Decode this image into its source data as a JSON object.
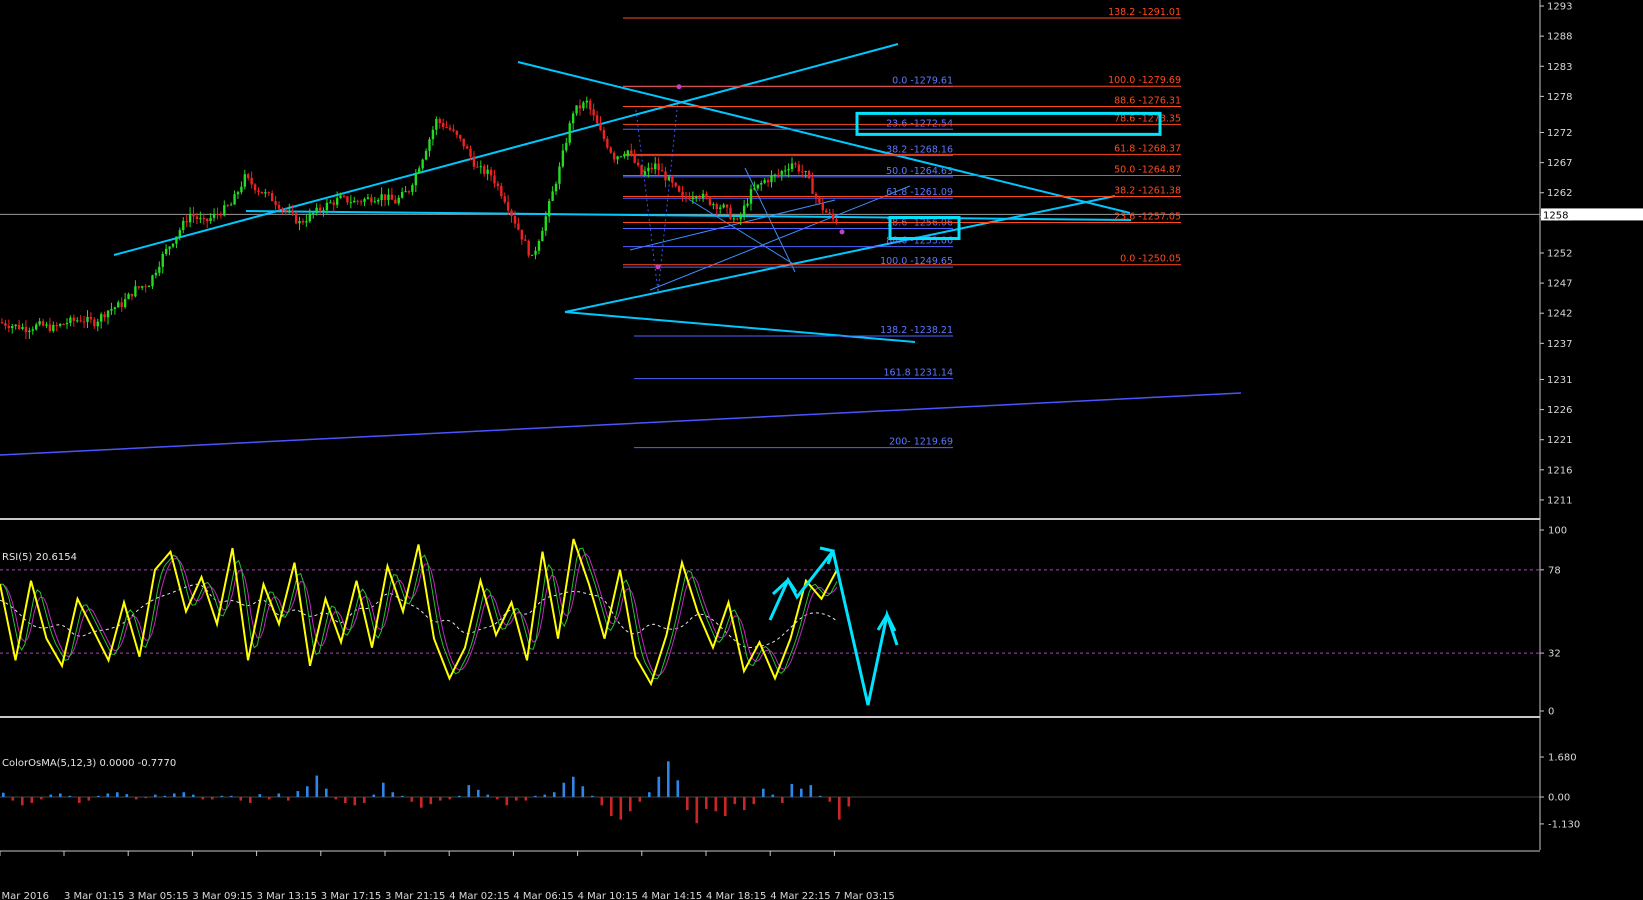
{
  "chart_data": [
    {
      "type": "candlestick",
      "panel": "price",
      "ylim": [
        1208,
        1294
      ],
      "y_ticks": [
        "1293",
        "1288",
        "1283",
        "1278",
        "1272",
        "1267",
        "1262",
        "1258",
        "1252",
        "1247",
        "1242",
        "1237",
        "1231",
        "1226",
        "1221",
        "1216",
        "1211"
      ],
      "x_ticks": [
        "2 Mar 2016",
        "3 Mar 01:15",
        "3 Mar 05:15",
        "3 Mar 09:15",
        "3 Mar 13:15",
        "3 Mar 17:15",
        "3 Mar 21:15",
        "4 Mar 02:15",
        "4 Mar 06:15",
        "4 Mar 10:15",
        "4 Mar 14:15",
        "4 Mar 18:15",
        "4 Mar 22:15",
        "7 Mar 03:15"
      ],
      "current_price_tag": "1258",
      "current_price": 1258.4,
      "close_path": [
        [
          0,
          1240.5
        ],
        [
          4,
          1240
        ],
        [
          8,
          1239.5
        ],
        [
          12,
          1240
        ],
        [
          16,
          1239.5
        ],
        [
          20,
          1240.5
        ],
        [
          24,
          1241
        ],
        [
          28,
          1240.5
        ],
        [
          32,
          1242.5
        ],
        [
          36,
          1243.5
        ],
        [
          40,
          1246
        ],
        [
          44,
          1247
        ],
        [
          48,
          1251.5
        ],
        [
          52,
          1255
        ],
        [
          56,
          1258.5
        ],
        [
          60,
          1257
        ],
        [
          64,
          1258.5
        ],
        [
          68,
          1260
        ],
        [
          72,
          1264.5
        ],
        [
          76,
          1262.5
        ],
        [
          80,
          1261
        ],
        [
          84,
          1259
        ],
        [
          88,
          1257
        ],
        [
          92,
          1258.5
        ],
        [
          96,
          1260
        ],
        [
          100,
          1261
        ],
        [
          104,
          1260.5
        ],
        [
          108,
          1261
        ],
        [
          112,
          1261.5
        ],
        [
          116,
          1260.5
        ],
        [
          120,
          1262.5
        ],
        [
          124,
          1268
        ],
        [
          128,
          1274
        ],
        [
          132,
          1272.5
        ],
        [
          136,
          1270
        ],
        [
          140,
          1266
        ],
        [
          144,
          1265
        ],
        [
          148,
          1261
        ],
        [
          152,
          1256
        ],
        [
          156,
          1251
        ],
        [
          160,
          1258
        ],
        [
          164,
          1266
        ],
        [
          168,
          1275.5
        ],
        [
          172,
          1277
        ],
        [
          176,
          1272
        ],
        [
          180,
          1268
        ],
        [
          184,
          1269
        ],
        [
          188,
          1265
        ],
        [
          192,
          1266.5
        ],
        [
          196,
          1264
        ],
        [
          200,
          1261
        ],
        [
          204,
          1262
        ],
        [
          208,
          1260.5
        ],
        [
          212,
          1259.5
        ],
        [
          216,
          1257
        ],
        [
          220,
          1262
        ],
        [
          224,
          1264
        ],
        [
          228,
          1265
        ],
        [
          232,
          1267
        ],
        [
          236,
          1265
        ],
        [
          240,
          1260
        ],
        [
          244,
          1257.5
        ]
      ],
      "fibonacci_blue": [
        {
          "label": "0.0 -1279.61",
          "price": 1279.61
        },
        {
          "label": "23.6 -1272.54",
          "price": 1272.54
        },
        {
          "label": "38.2 -1268.16",
          "price": 1268.16
        },
        {
          "label": "50.0 -1264.63",
          "price": 1264.63
        },
        {
          "label": "61.8 -1261.09",
          "price": 1261.09
        },
        {
          "label": "78.6 -1256.06",
          "price": 1256.06
        },
        {
          "label": "88.6 -1253.06",
          "price": 1253.06
        },
        {
          "label": "100.0 -1249.65",
          "price": 1249.65
        },
        {
          "label": "138.2  -1238.21",
          "price": 1238.21
        },
        {
          "label": "161.8 1231.14",
          "price": 1231.14
        },
        {
          "label": "200- 1219.69",
          "price": 1219.69
        }
      ],
      "fibonacci_red": [
        {
          "label": "138.2  -1291.01",
          "price": 1291.01
        },
        {
          "label": "100.0 -1279.69",
          "price": 1279.69
        },
        {
          "label": "88.6 -1276.31",
          "price": 1276.31
        },
        {
          "label": "78.6 -1273.35",
          "price": 1273.35
        },
        {
          "label": "61.8 -1268.37",
          "price": 1268.37
        },
        {
          "label": "50.0 -1264.87",
          "price": 1264.87
        },
        {
          "label": "38.2 -1261.38",
          "price": 1261.38
        },
        {
          "label": "23.6 -1257.05",
          "price": 1257.05
        },
        {
          "label": "0.0 -1250.05",
          "price": 1250.05
        }
      ],
      "highlighted_levels": [
        "78.6 -1273.35",
        "78.6 -1256.06"
      ],
      "colors": {
        "bull": "#22dd22",
        "bear": "#ee2222",
        "trendline": "#00c8ff",
        "fib_blue": "#4f64ff",
        "fib_red": "#ff4a1c",
        "highlight": "#00e5ff"
      }
    },
    {
      "type": "line",
      "panel": "oscillator",
      "title": "RSI(5) 20.6154",
      "ylim": [
        0,
        100
      ],
      "y_ticks": [
        "100",
        "78",
        "32",
        "0"
      ],
      "levels": [
        78,
        32
      ],
      "series_values": [
        [
          0,
          70
        ],
        [
          5,
          28
        ],
        [
          10,
          72
        ],
        [
          15,
          40
        ],
        [
          20,
          25
        ],
        [
          25,
          62
        ],
        [
          30,
          45
        ],
        [
          35,
          28
        ],
        [
          40,
          60
        ],
        [
          45,
          30
        ],
        [
          50,
          78
        ],
        [
          55,
          88
        ],
        [
          60,
          55
        ],
        [
          65,
          74
        ],
        [
          70,
          48
        ],
        [
          75,
          90
        ],
        [
          80,
          28
        ],
        [
          85,
          70
        ],
        [
          90,
          48
        ],
        [
          95,
          82
        ],
        [
          100,
          25
        ],
        [
          105,
          62
        ],
        [
          110,
          38
        ],
        [
          115,
          72
        ],
        [
          120,
          35
        ],
        [
          125,
          80
        ],
        [
          130,
          55
        ],
        [
          135,
          92
        ],
        [
          140,
          40
        ],
        [
          145,
          18
        ],
        [
          150,
          35
        ],
        [
          155,
          72
        ],
        [
          160,
          42
        ],
        [
          165,
          60
        ],
        [
          170,
          28
        ],
        [
          175,
          88
        ],
        [
          180,
          40
        ],
        [
          185,
          95
        ],
        [
          190,
          70
        ],
        [
          195,
          40
        ],
        [
          200,
          78
        ],
        [
          205,
          30
        ],
        [
          210,
          15
        ],
        [
          215,
          42
        ],
        [
          220,
          82
        ],
        [
          225,
          55
        ],
        [
          230,
          35
        ],
        [
          235,
          60
        ],
        [
          240,
          22
        ],
        [
          245,
          38
        ],
        [
          250,
          18
        ],
        [
          255,
          40
        ],
        [
          260,
          72
        ],
        [
          265,
          62
        ],
        [
          270,
          78
        ],
        [
          275,
          20
        ]
      ],
      "colors": {
        "rsi": "#ffff00",
        "signal_fast": "#22c42a",
        "signal_slow": "#c226c2",
        "average": "#e6e6e6",
        "level": "#b040c0",
        "arrow": "#00e5ff"
      }
    },
    {
      "type": "bar",
      "panel": "histogram",
      "title": "ColorOsMA(5,12,3) 0.0000 -0.7770",
      "ylim": [
        -1.13,
        1.68
      ],
      "y_ticks": [
        "1.680",
        "0.00",
        "-1.130"
      ],
      "bar_values": [
        0.18,
        -0.15,
        -0.35,
        -0.25,
        -0.1,
        0.1,
        0.15,
        0.05,
        -0.25,
        -0.15,
        0.05,
        0.15,
        0.2,
        0.12,
        -0.1,
        -0.05,
        0.1,
        0.05,
        0.15,
        0.2,
        0.1,
        -0.1,
        -0.1,
        0.05,
        0.05,
        -0.15,
        -0.25,
        0.12,
        -0.1,
        0.15,
        -0.15,
        0.25,
        0.45,
        0.9,
        0.35,
        -0.1,
        -0.25,
        -0.35,
        -0.25,
        0.1,
        0.6,
        0.2,
        0.05,
        -0.2,
        -0.45,
        -0.3,
        -0.15,
        -0.1,
        0.05,
        0.5,
        0.3,
        0.1,
        -0.1,
        -0.35,
        -0.15,
        -0.15,
        0.05,
        0.1,
        0.2,
        0.6,
        0.85,
        0.45,
        0.05,
        -0.35,
        -0.8,
        -0.95,
        -0.6,
        -0.2,
        0.2,
        0.85,
        1.5,
        0.7,
        -0.55,
        -1.1,
        -0.5,
        -0.6,
        -0.8,
        -0.3,
        -0.55,
        -0.3,
        0.35,
        0.1,
        -0.25,
        0.55,
        0.35,
        0.5,
        0.05,
        -0.2,
        -0.95,
        -0.4
      ],
      "colors": {
        "positive": "#2f86e6",
        "negative": "#cc2525",
        "zero_line": "#888888"
      }
    }
  ]
}
